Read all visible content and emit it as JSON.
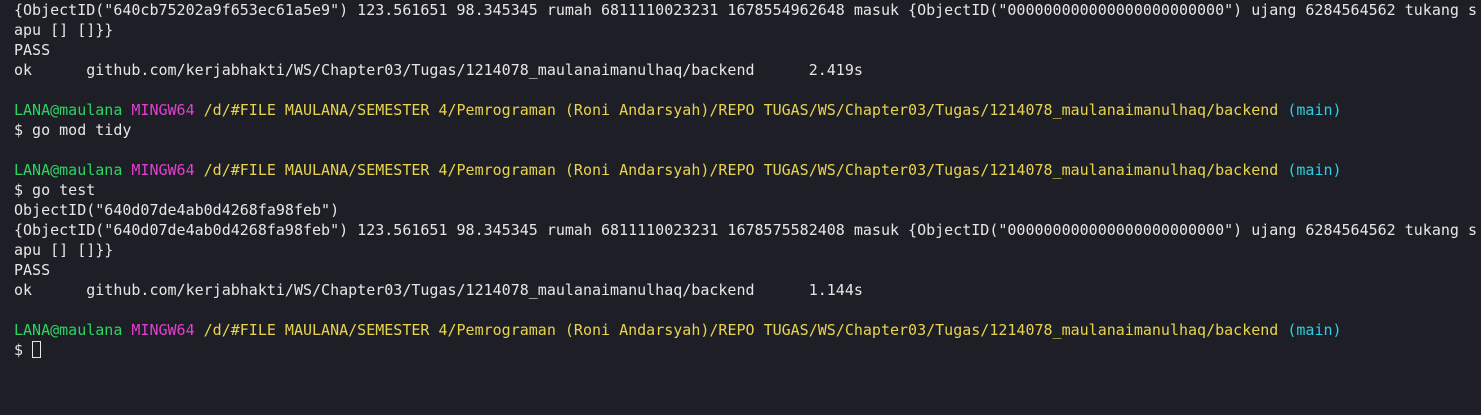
{
  "colors": {
    "background": "#1e1f26",
    "text": "#e6e6e6",
    "user": "#2bd463",
    "host": "#e33fd2",
    "path": "#e8d44d",
    "branch": "#2ecde6"
  },
  "lines": {
    "l1": "{ObjectID(\"640cb75202a9f653ec61a5e9\") 123.561651 98.345345 rumah 6811110023231 1678554962648 masuk {ObjectID(\"000000000000000000000000\") ujang 6284564562 tukang s",
    "l2": "apu [] []}}",
    "l3": "PASS",
    "l4": "ok      github.com/kerjabhakti/WS/Chapter03/Tugas/1214078_maulanaimanulhaq/backend      2.419s",
    "cmd1": "$ go mod tidy",
    "cmd2": "$ go test",
    "l8": "ObjectID(\"640d07de4ab0d4268fa98feb\")",
    "l9": "{ObjectID(\"640d07de4ab0d4268fa98feb\") 123.561651 98.345345 rumah 6811110023231 1678575582408 masuk {ObjectID(\"000000000000000000000000\") ujang 6284564562 tukang s",
    "l10": "apu [] []}}",
    "l11": "PASS",
    "l12": "ok      github.com/kerjabhakti/WS/Chapter03/Tugas/1214078_maulanaimanulhaq/backend      1.144s",
    "cmd3": "$ "
  },
  "prompt": {
    "user": "LANA@maulana",
    "host": "MINGW64",
    "path": "/d/#FILE MAULANA/SEMESTER 4/Pemrograman (Roni Andarsyah)/REPO TUGAS/WS/Chapter03/Tugas/1214078_maulanaimanulhaq/backend",
    "branch": "(main)"
  }
}
